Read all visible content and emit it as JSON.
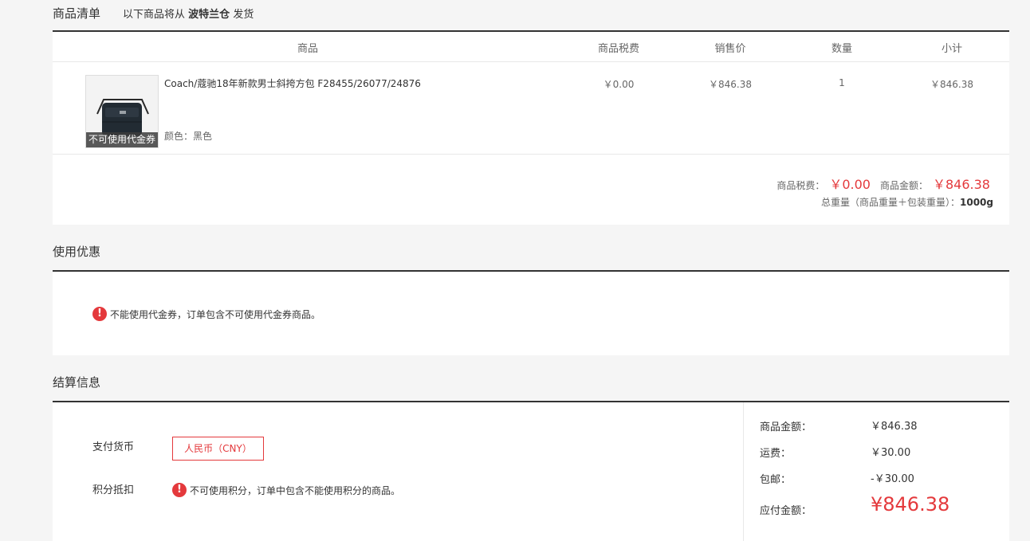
{
  "goods": {
    "title": "商品清单",
    "ship_prefix": "以下商品将从",
    "warehouse": "波特兰仓",
    "ship_suffix": "发货",
    "columns": [
      "商品",
      "商品税费",
      "销售价",
      "数量",
      "小计"
    ],
    "item": {
      "name": "Coach/蔻驰18年新款男士斜挎方包 F28455/26077/24876",
      "color": "颜色：黑色",
      "badge": "不可使用代金券",
      "tax": "￥0.00",
      "price": "￥846.38",
      "qty": "1",
      "subtotal": "￥846.38"
    },
    "summary": {
      "tax_label": "商品税费：",
      "tax_value": "￥0.00",
      "amount_label": "商品金额：",
      "amount_value": "￥846.38",
      "weight_label": "总重量（商品重量＋包装重量）：",
      "weight_value": "1000g"
    }
  },
  "coupon": {
    "title": "使用优惠",
    "warning": "不能使用代金券，订单包含不可使用代金券商品。"
  },
  "settle": {
    "title": "结算信息",
    "currency_label": "支付货币",
    "currency_value": "人民币（CNY）",
    "points_label": "积分抵扣",
    "points_warning": "不可使用积分，订单中包含不能使用积分的商品。",
    "rows": [
      {
        "label": "商品金额：",
        "value": "￥846.38"
      },
      {
        "label": "运费：",
        "value": "￥30.00"
      },
      {
        "label": "包邮：",
        "value": "-￥30.00"
      },
      {
        "label": "应付金额：",
        "value": "¥846.38"
      }
    ]
  },
  "colors": {
    "accent": "#e4393c",
    "border_dark": "#333333",
    "bg": "#f5f5f5"
  },
  "icons": {
    "warning": "exclamation-circle-icon",
    "product": "bag-icon"
  }
}
